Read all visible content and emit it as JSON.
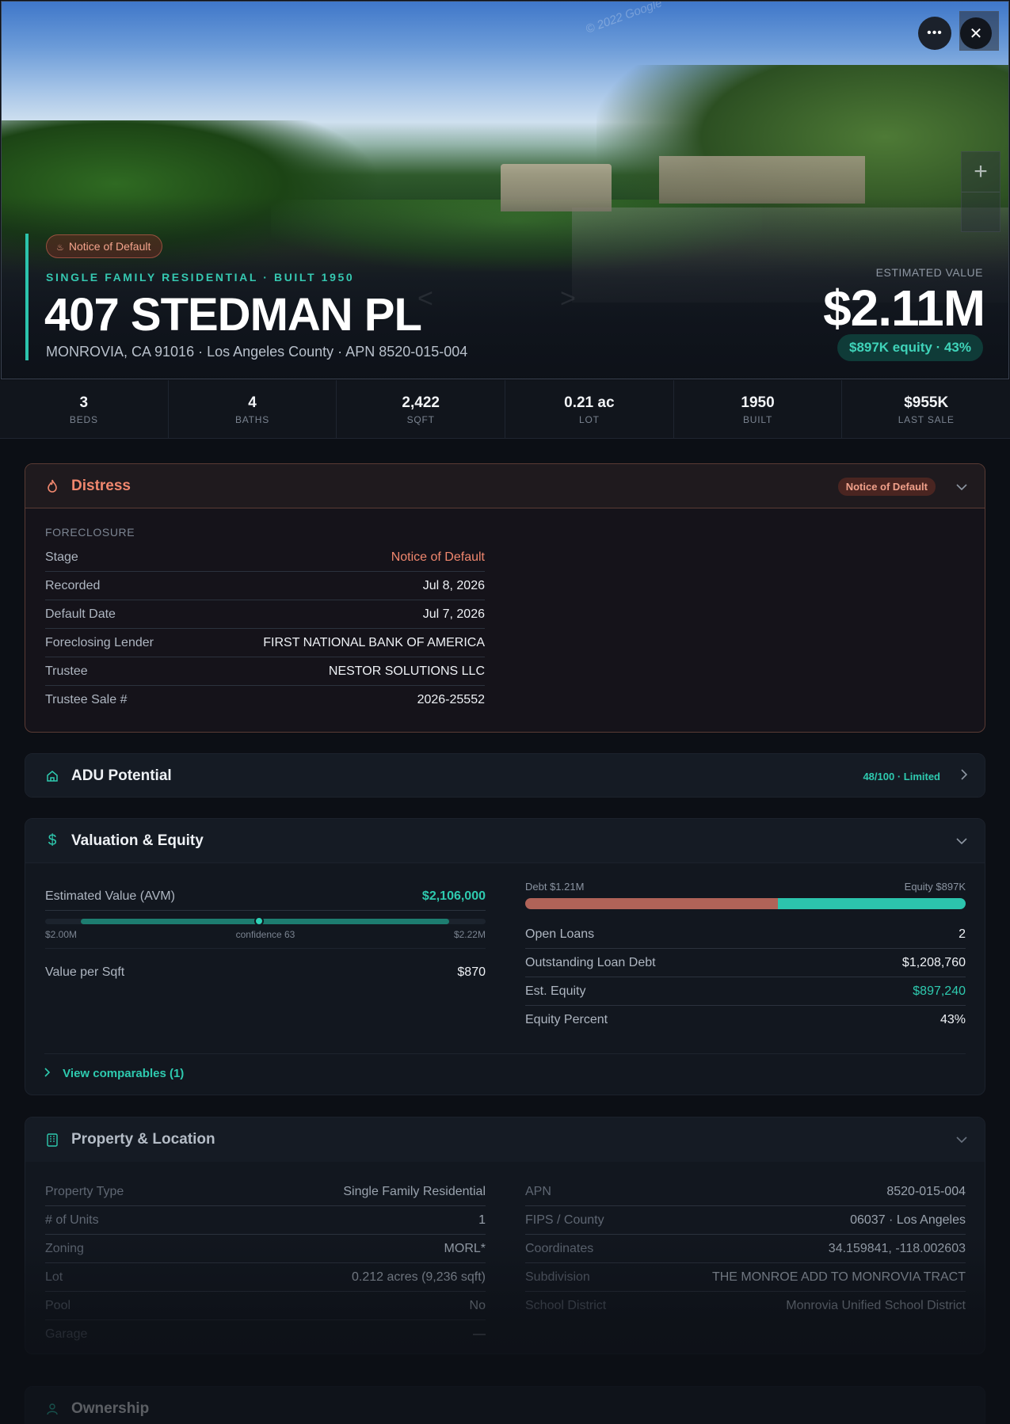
{
  "hero": {
    "watermark": "© 2022 Google",
    "badge": "Notice of Default",
    "subtitle": "SINGLE FAMILY RESIDENTIAL · BUILT 1950",
    "title": "407 STEDMAN PL",
    "address": "MONROVIA, CA 91016 · Los Angeles County · APN 8520-015-004",
    "est_label": "ESTIMATED VALUE",
    "est_value": "$2.11M",
    "equity_pill": "$897K equity · 43%",
    "zoom_in": "+"
  },
  "stats": [
    {
      "value": "3",
      "label": "BEDS"
    },
    {
      "value": "4",
      "label": "BATHS"
    },
    {
      "value": "2,422",
      "label": "SQFT"
    },
    {
      "value": "0.21 ac",
      "label": "LOT"
    },
    {
      "value": "1950",
      "label": "BUILT"
    },
    {
      "value": "$955K",
      "label": "LAST SALE"
    }
  ],
  "distress": {
    "title": "Distress",
    "badge": "Notice of Default",
    "section": "FORECLOSURE",
    "rows": [
      {
        "k": "Stage",
        "v": "Notice of Default"
      },
      {
        "k": "Recorded",
        "v": "Jul 8, 2026"
      },
      {
        "k": "Default Date",
        "v": "Jul 7, 2026"
      },
      {
        "k": "Foreclosing Lender",
        "v": "FIRST NATIONAL BANK OF AMERICA"
      },
      {
        "k": "Trustee",
        "v": "NESTOR SOLUTIONS LLC"
      },
      {
        "k": "Trustee Sale #",
        "v": "2026-25552"
      }
    ]
  },
  "adu": {
    "title": "ADU Potential",
    "score": "48/100 · Limited"
  },
  "valuation": {
    "title": "Valuation & Equity",
    "avm_label": "Estimated Value (AVM)",
    "avm_value": "$2,106,000",
    "avm_low": "$2.00M",
    "avm_confidence": "confidence 63",
    "avm_high": "$2.22M",
    "avm_position": 0.485,
    "vps_label": "Value per Sqft",
    "vps_value": "$870",
    "debt_label": "Debt $1.21M",
    "equity_label": "Equity $897K",
    "debt_fraction": 0.574,
    "rows": [
      {
        "k": "Open Loans",
        "v": "2"
      },
      {
        "k": "Outstanding Loan Debt",
        "v": "$1,208,760"
      },
      {
        "k": "Est. Equity",
        "v": "$897,240"
      },
      {
        "k": "Equity Percent",
        "v": "43%"
      }
    ],
    "comparables": "View comparables (1)"
  },
  "property": {
    "title": "Property & Location",
    "left": [
      {
        "k": "Property Type",
        "v": "Single Family Residential"
      },
      {
        "k": "# of Units",
        "v": "1"
      },
      {
        "k": "Zoning",
        "v": "MORL*"
      },
      {
        "k": "Lot",
        "v": "0.212 acres (9,236 sqft)"
      },
      {
        "k": "Pool",
        "v": "No"
      },
      {
        "k": "Garage",
        "v": "—"
      }
    ],
    "right": [
      {
        "k": "APN",
        "v": "8520-015-004"
      },
      {
        "k": "FIPS / County",
        "v": "06037 · Los Angeles"
      },
      {
        "k": "Coordinates",
        "v": "34.159841, -118.002603"
      },
      {
        "k": "Subdivision",
        "v": "THE MONROE ADD TO MONROVIA TRACT"
      },
      {
        "k": "School District",
        "v": "Monrovia Unified School District"
      }
    ]
  },
  "ownership": {
    "title": "Ownership"
  },
  "colors": {
    "accent": "#2cc4ad",
    "distress": "#f0876e",
    "debt": "#b06358"
  }
}
